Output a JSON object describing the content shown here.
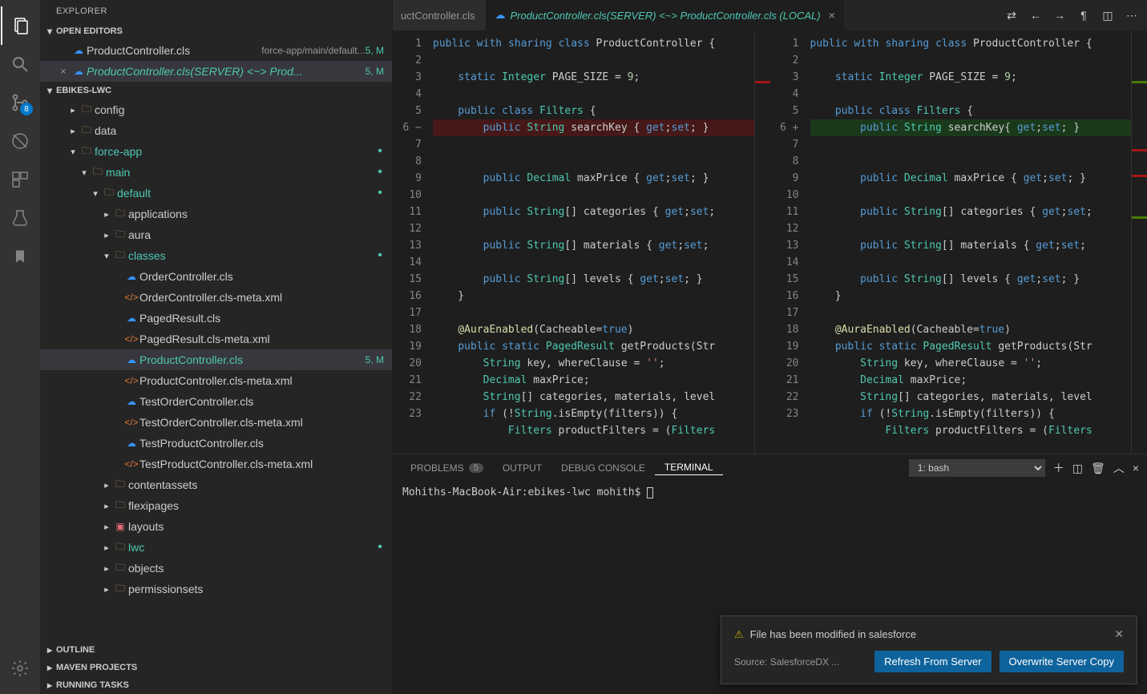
{
  "sidebar_title": "EXPLORER",
  "scm_badge": "8",
  "open_editors": {
    "header": "OPEN EDITORS",
    "items": [
      {
        "name": "ProductController.cls",
        "path": "force-app/main/default...",
        "status": "5, M",
        "diff": false
      },
      {
        "name": "ProductController.cls(SERVER) <~> Prod...",
        "path": "",
        "status": "5, M",
        "diff": true,
        "active": true
      }
    ]
  },
  "workspace": {
    "header": "EBIKES-LWC",
    "tree": [
      {
        "indent": 1,
        "twistie": ">",
        "icon": "folder",
        "label": "config"
      },
      {
        "indent": 1,
        "twistie": ">",
        "icon": "folder",
        "label": "data"
      },
      {
        "indent": 1,
        "twistie": "v",
        "icon": "folder",
        "label": "force-app",
        "green": true,
        "dot": true
      },
      {
        "indent": 2,
        "twistie": "v",
        "icon": "folder",
        "label": "main",
        "green": true,
        "dot": true
      },
      {
        "indent": 3,
        "twistie": "v",
        "icon": "folder",
        "label": "default",
        "green": true,
        "dot": true
      },
      {
        "indent": 4,
        "twistie": ">",
        "icon": "folder",
        "label": "applications"
      },
      {
        "indent": 4,
        "twistie": ">",
        "icon": "folder",
        "label": "aura"
      },
      {
        "indent": 4,
        "twistie": "v",
        "icon": "folder",
        "label": "classes",
        "green": true,
        "dot": true
      },
      {
        "indent": 5,
        "twistie": "",
        "icon": "cloud",
        "label": "OrderController.cls"
      },
      {
        "indent": 5,
        "twistie": "",
        "icon": "xml",
        "label": "OrderController.cls-meta.xml"
      },
      {
        "indent": 5,
        "twistie": "",
        "icon": "cloud",
        "label": "PagedResult.cls"
      },
      {
        "indent": 5,
        "twistie": "",
        "icon": "xml",
        "label": "PagedResult.cls-meta.xml"
      },
      {
        "indent": 5,
        "twistie": "",
        "icon": "cloud",
        "label": "ProductController.cls",
        "green": true,
        "status": "5, M",
        "active": true
      },
      {
        "indent": 5,
        "twistie": "",
        "icon": "xml",
        "label": "ProductController.cls-meta.xml"
      },
      {
        "indent": 5,
        "twistie": "",
        "icon": "cloud",
        "label": "TestOrderController.cls"
      },
      {
        "indent": 5,
        "twistie": "",
        "icon": "xml",
        "label": "TestOrderController.cls-meta.xml"
      },
      {
        "indent": 5,
        "twistie": "",
        "icon": "cloud",
        "label": "TestProductController.cls"
      },
      {
        "indent": 5,
        "twistie": "",
        "icon": "xml",
        "label": "TestProductController.cls-meta.xml"
      },
      {
        "indent": 4,
        "twistie": ">",
        "icon": "folder",
        "label": "contentassets"
      },
      {
        "indent": 4,
        "twistie": ">",
        "icon": "folder",
        "label": "flexipages"
      },
      {
        "indent": 4,
        "twistie": ">",
        "icon": "red",
        "label": "layouts"
      },
      {
        "indent": 4,
        "twistie": ">",
        "icon": "folder",
        "label": "lwc",
        "green": true,
        "dot": true
      },
      {
        "indent": 4,
        "twistie": ">",
        "icon": "folder",
        "label": "objects"
      },
      {
        "indent": 4,
        "twistie": ">",
        "icon": "folder",
        "label": "permissionsets"
      }
    ]
  },
  "outline_header": "OUTLINE",
  "maven_header": "MAVEN PROJECTS",
  "running_header": "RUNNING TASKS",
  "tabs": {
    "inactive_label": "uctController.cls",
    "active_label": "ProductController.cls(SERVER) <~> ProductController.cls (LOCAL)"
  },
  "editor": {
    "left_lines": [
      "public with sharing class ProductController {",
      "",
      "    static Integer PAGE_SIZE = 9;",
      "",
      "    public class Filters {",
      "        public String searchKey { get;set; }",
      "",
      "        public Decimal maxPrice { get;set; }",
      "",
      "        public String[] categories { get;set;",
      "",
      "        public String[] materials { get;set;",
      "",
      "        public String[] levels { get;set; }",
      "    }",
      "",
      "    @AuraEnabled(Cacheable=true)",
      "    public static PagedResult getProducts(Str",
      "        String key, whereClause = '';",
      "        Decimal maxPrice;",
      "        String[] categories, materials, level",
      "        if (!String.isEmpty(filters)) {",
      "            Filters productFilters = (Filters"
    ],
    "right_lines": [
      "public with sharing class ProductController {",
      "",
      "    static Integer PAGE_SIZE = 9;",
      "",
      "    public class Filters {",
      "        public String searchKey{ get;set; }",
      "",
      "        public Decimal maxPrice { get;set; }",
      "",
      "        public String[] categories { get;set;",
      "",
      "        public String[] materials { get;set;",
      "",
      "        public String[] levels { get;set; }",
      "    }",
      "",
      "    @AuraEnabled(Cacheable=true)",
      "    public static PagedResult getProducts(Str",
      "        String key, whereClause = '';",
      "        Decimal maxPrice;",
      "        String[] categories, materials, level",
      "        if (!String.isEmpty(filters)) {",
      "            Filters productFilters = (Filters"
    ],
    "line_count": 23
  },
  "panel": {
    "problems": "PROBLEMS",
    "problems_count": "5",
    "output": "OUTPUT",
    "debug": "DEBUG CONSOLE",
    "terminal": "TERMINAL",
    "shell_select": "1: bash",
    "prompt": "Mohiths-MacBook-Air:ebikes-lwc mohith$ "
  },
  "notification": {
    "message": "File has been modified in salesforce",
    "source": "Source: SalesforceDX ...",
    "btn_refresh": "Refresh From Server",
    "btn_overwrite": "Overwrite Server Copy"
  }
}
